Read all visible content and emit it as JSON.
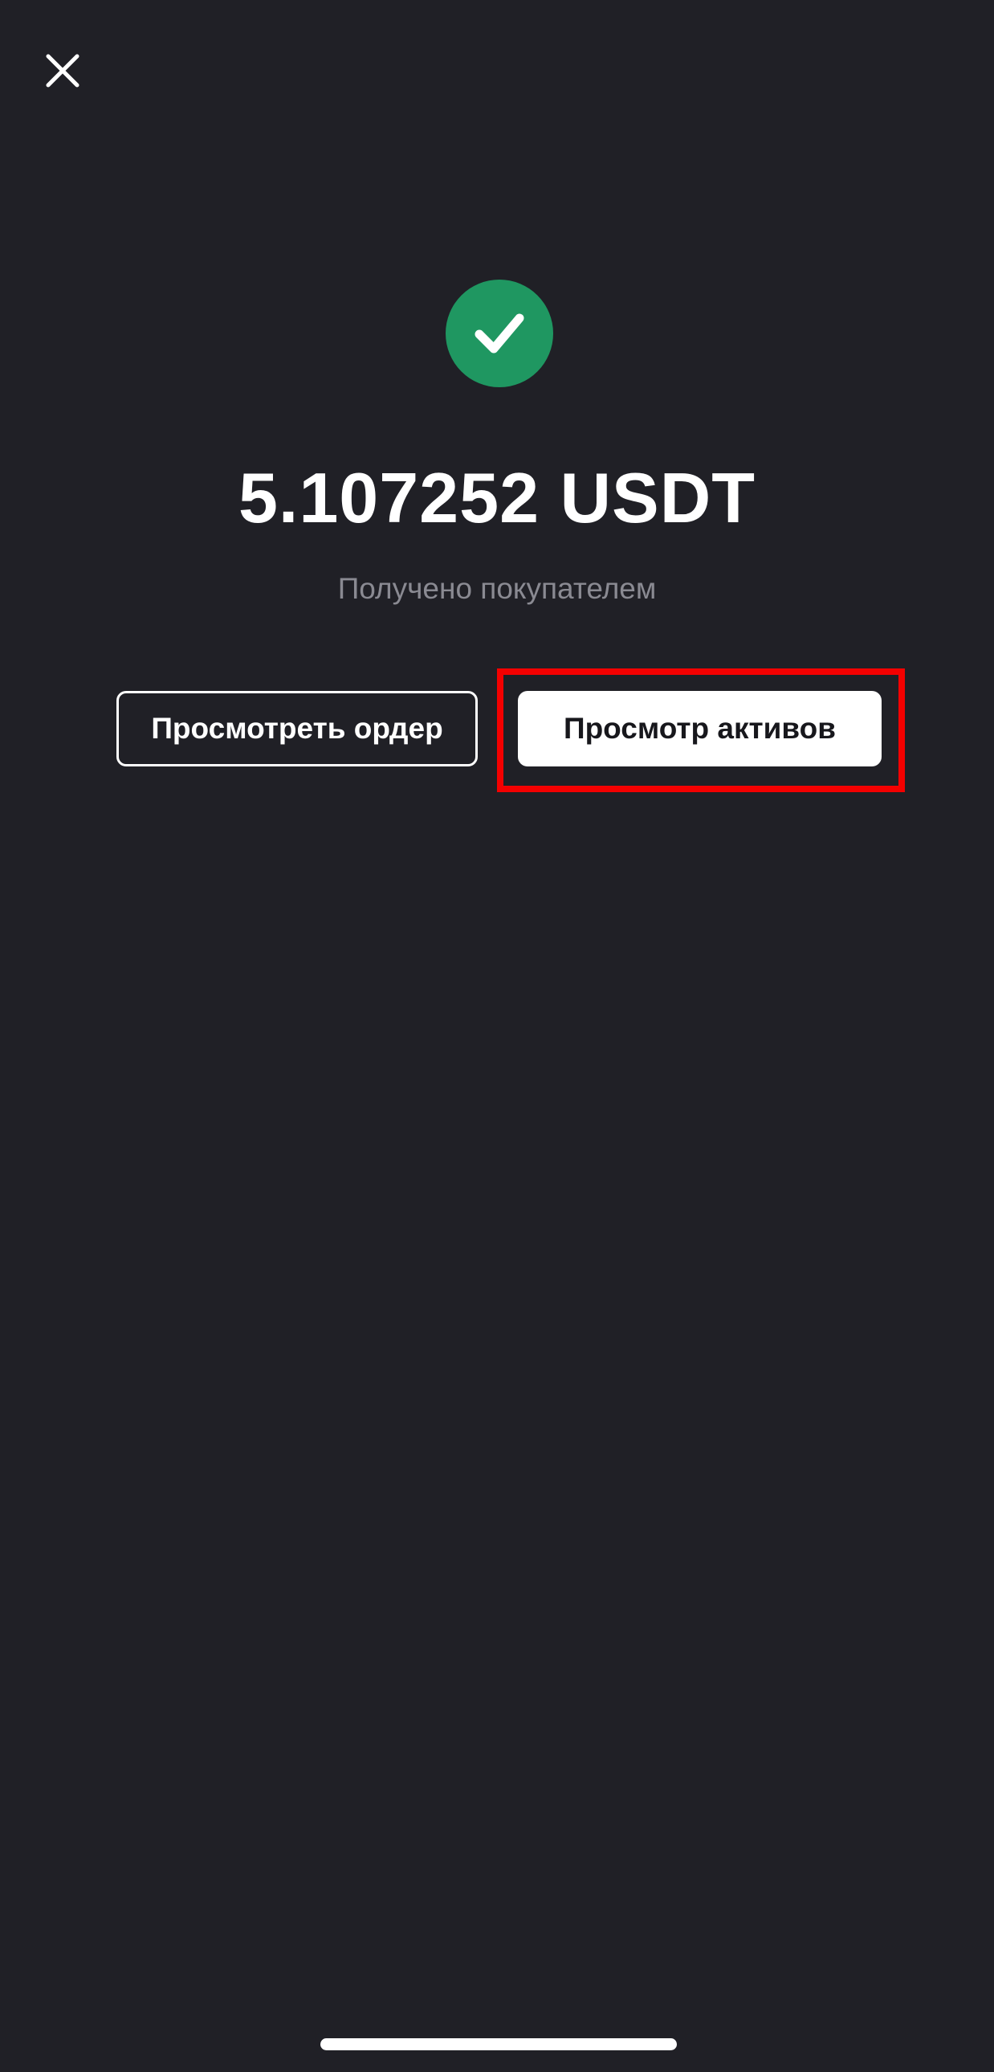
{
  "header": {
    "close_icon": "close-icon"
  },
  "status": {
    "icon": "checkmark-icon",
    "icon_color": "#1f9761",
    "amount": "5.107252 USDT",
    "subtitle": "Получено покупателем"
  },
  "actions": {
    "view_order_label": "Просмотреть ордер",
    "view_assets_label": "Просмотр активов"
  },
  "colors": {
    "background": "#202026",
    "highlight": "#f40000"
  }
}
